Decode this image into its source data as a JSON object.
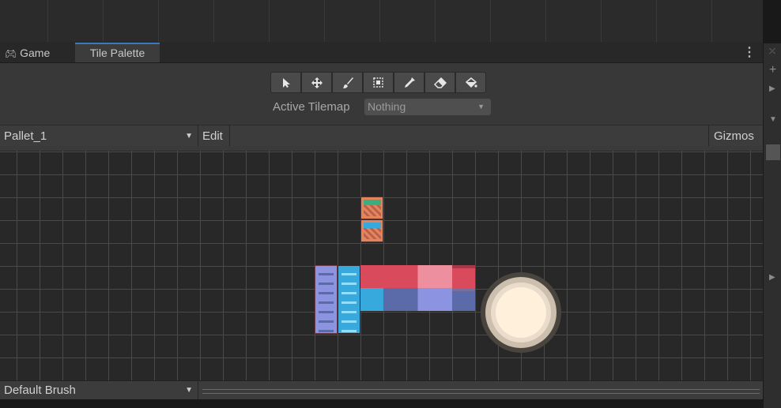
{
  "tabs": {
    "game_label": "Game",
    "tile_palette_label": "Tile Palette"
  },
  "toolbar": {
    "tools": [
      "select-tool",
      "move-tool",
      "paint-tool",
      "box-fill-tool",
      "pick-tool",
      "erase-tool",
      "flood-fill-tool"
    ],
    "active_tilemap_label": "Active Tilemap",
    "active_tilemap_value": "Nothing"
  },
  "palette_bar": {
    "palette_value": "Pallet_1",
    "edit_label": "Edit",
    "gizmos_label": "Gizmos"
  },
  "brush_bar": {
    "brush_value": "Default Brush"
  },
  "colors": {
    "tab_accent": "#3a79bb",
    "tile_red": "#d94a5c",
    "tile_pink": "#ee8fa0",
    "tile_blue": "#37a9dd",
    "tile_lavender": "#8c93e0",
    "tile_slate": "#5b6aa8",
    "tile_orange": "#e3845d",
    "tile_green": "#3aae7e",
    "sun_core": "#fff0dc",
    "sun_ring": "#cdbfae"
  }
}
